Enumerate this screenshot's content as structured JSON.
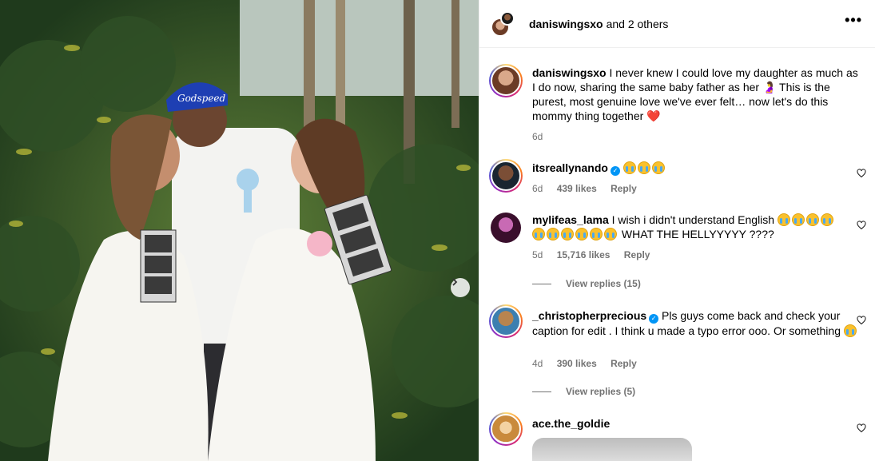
{
  "header": {
    "username": "daniswingsxo",
    "rest": "and 2 others",
    "more_label": "•••"
  },
  "caption": {
    "username": "daniswingsxo",
    "text": "I never knew I could love my daughter as much as I do now, sharing the same baby father as her 🤰 This is the purest, most genuine love we've ever felt… now let's do this mommy thing together",
    "heart": "❤️",
    "time": "6d"
  },
  "comments": [
    {
      "username": "itsreallynando",
      "verified": true,
      "text": "",
      "time": "6d",
      "likes": "439 likes",
      "reply": "Reply"
    },
    {
      "username": "mylifeas_lama",
      "verified": false,
      "text": "I wish i didn't understand English",
      "text2": "WHAT THE HELLYYYYY ????",
      "time": "5d",
      "likes": "15,716 likes",
      "reply": "Reply",
      "view_replies": "View replies (15)"
    },
    {
      "username": "_christopherprecious",
      "verified": true,
      "text": "Pls guys come back and check your caption for edit . I think u made a typo error ooo. Or something",
      "time": "4d",
      "likes": "390 likes",
      "reply": "Reply",
      "view_replies": "View replies (5)"
    },
    {
      "username": "ace.the_goldie",
      "verified": false
    }
  ],
  "icons": {
    "next": "chevron-right-icon",
    "heart": "heart-outline-icon",
    "verified": "verified-badge-icon"
  },
  "colors": {
    "link_blue": "#0095f6",
    "meta_gray": "#737373"
  }
}
